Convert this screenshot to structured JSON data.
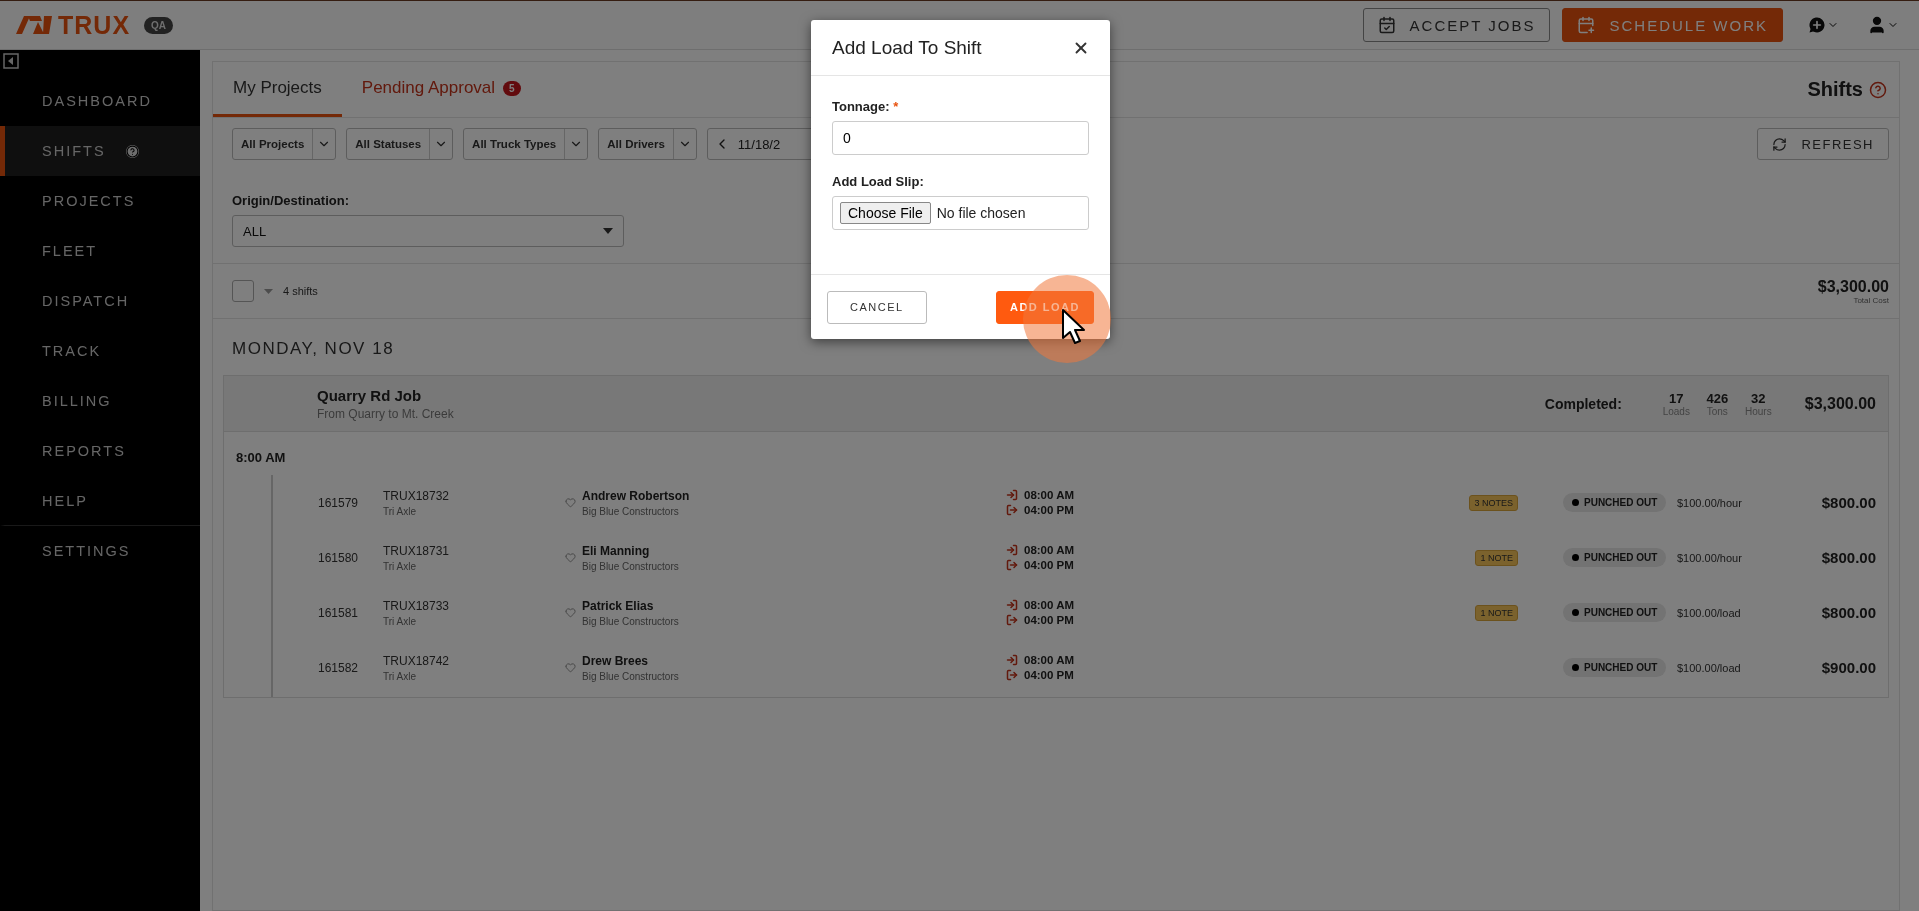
{
  "header": {
    "logo": "TRUX",
    "env_badge": "QA",
    "buttons": [
      {
        "label": "ACCEPT JOBS",
        "kind": "outline"
      },
      {
        "label": "SCHEDULE WORK",
        "kind": "primary"
      }
    ]
  },
  "sidebar": {
    "items": [
      {
        "label": "DASHBOARD",
        "selected": false,
        "help": false
      },
      {
        "label": "SHIFTS",
        "selected": true,
        "help": true
      },
      {
        "label": "PROJECTS",
        "selected": false,
        "help": false
      },
      {
        "label": "FLEET",
        "selected": false,
        "help": false
      },
      {
        "label": "DISPATCH",
        "selected": false,
        "help": false
      },
      {
        "label": "TRACK",
        "selected": false,
        "help": false
      },
      {
        "label": "BILLING",
        "selected": false,
        "help": false
      },
      {
        "label": "REPORTS",
        "selected": false,
        "help": false
      },
      {
        "label": "HELP",
        "selected": false,
        "help": false
      },
      {
        "label": "SETTINGS",
        "selected": false,
        "help": false
      }
    ]
  },
  "tabs": [
    {
      "label": "My Projects",
      "selected": true,
      "kind": "plain"
    },
    {
      "label": "Pending Approval",
      "selected": false,
      "kind": "alert",
      "badge": "5"
    }
  ],
  "page_title": "Shifts",
  "filters": [
    {
      "label": "All Projects"
    },
    {
      "label": "All Statuses"
    },
    {
      "label": "All Truck Types"
    },
    {
      "label": "All Drivers"
    }
  ],
  "date": "11/18/2",
  "refresh": "REFRESH",
  "origin": {
    "label": "Origin/Destination:",
    "value": "ALL"
  },
  "summary": {
    "checked": false,
    "count": "4 shifts",
    "total": "$3,300.00",
    "total_label": "Total Cost"
  },
  "day": "MONDAY, NOV 18",
  "job": {
    "title": "Quarry Rd Job",
    "route": "From Quarry to Mt. Creek",
    "completed_label": "Completed:",
    "stats": [
      {
        "value": "17",
        "label": "Loads"
      },
      {
        "value": "426",
        "label": "Tons"
      },
      {
        "value": "32",
        "label": "Hours"
      }
    ],
    "total": "$3,300.00",
    "time": "8:00 AM",
    "shifts": [
      {
        "id": "161579",
        "truck": "TRUX18732",
        "truck_type": "Tri Axle",
        "driver": "Andrew Robertson",
        "company": "Big Blue Constructors",
        "start": "08:00 AM",
        "end": "04:00 PM",
        "notes": "3 NOTES",
        "status": "PUNCHED OUT",
        "rate": "$100.00/hour",
        "amount": "$800.00"
      },
      {
        "id": "161580",
        "truck": "TRUX18731",
        "truck_type": "Tri Axle",
        "driver": "Eli Manning",
        "company": "Big Blue Constructors",
        "start": "08:00 AM",
        "end": "04:00 PM",
        "notes": "1 NOTE",
        "status": "PUNCHED OUT",
        "rate": "$100.00/hour",
        "amount": "$800.00"
      },
      {
        "id": "161581",
        "truck": "TRUX18733",
        "truck_type": "Tri Axle",
        "driver": "Patrick Elias",
        "company": "Big Blue Constructors",
        "start": "08:00 AM",
        "end": "04:00 PM",
        "notes": "1 NOTE",
        "status": "PUNCHED OUT",
        "rate": "$100.00/load",
        "amount": "$800.00"
      },
      {
        "id": "161582",
        "truck": "TRUX18742",
        "truck_type": "Tri Axle",
        "driver": "Drew Brees",
        "company": "Big Blue Constructors",
        "start": "08:00 AM",
        "end": "04:00 PM",
        "status": "PUNCHED OUT",
        "rate": "$100.00/load",
        "amount": "$900.00"
      }
    ]
  },
  "modal": {
    "title": "Add Load To Shift",
    "fields": [
      {
        "kind": "number",
        "label": "Tonnage:",
        "required_mark": "*",
        "value": "0"
      },
      {
        "kind": "file",
        "label": "Add Load Slip:",
        "button": "Choose File",
        "value": "No file chosen"
      }
    ],
    "buttons": [
      {
        "label": "CANCEL",
        "kind": "secondary"
      },
      {
        "label": "ADD LOAD",
        "kind": "primary"
      }
    ]
  }
}
